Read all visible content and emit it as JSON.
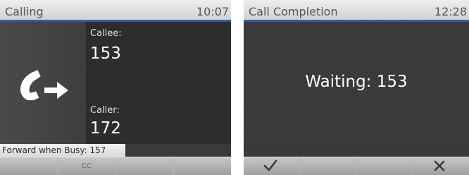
{
  "calling_screen": {
    "title": "Calling",
    "time": "10:07",
    "callee_label": "Callee:",
    "callee_number": "153",
    "caller_label": "Caller:",
    "caller_number": "172",
    "forward_status": "Forward when Busy: 157",
    "softkeys": [
      "",
      "CC",
      "",
      ""
    ]
  },
  "call_completion_screen": {
    "title": "Call Completion",
    "time": "12:28",
    "waiting_text": "Waiting: 153",
    "softkeys": [
      "check-icon",
      "",
      "",
      "close-icon"
    ]
  },
  "colors": {
    "title_underline": "#2f5da3",
    "panel_dark": "#2d2d2d"
  }
}
